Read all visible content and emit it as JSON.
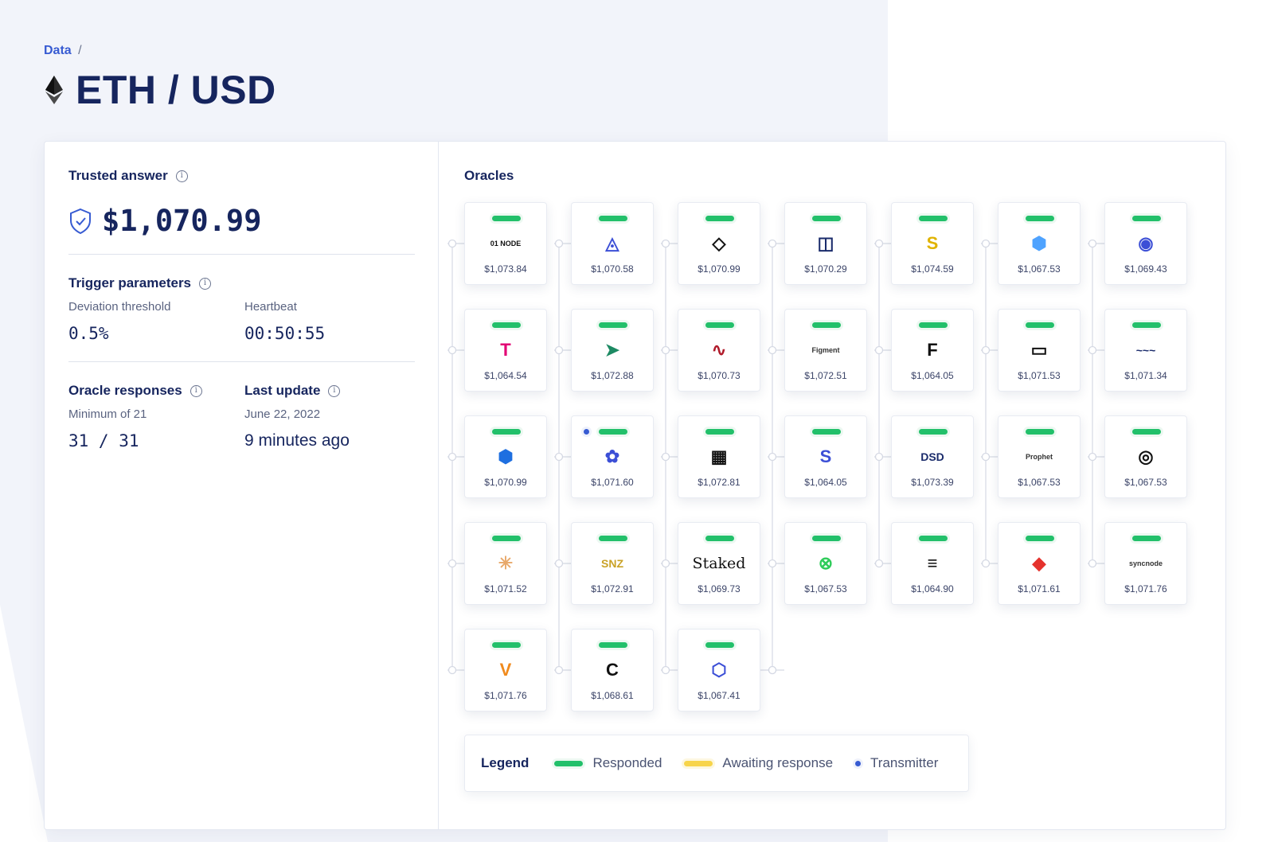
{
  "breadcrumb": {
    "root": "Data",
    "separator": "/"
  },
  "page": {
    "title": "ETH / USD",
    "icon": "ethereum-icon"
  },
  "trusted_answer": {
    "label": "Trusted answer",
    "value": "$1,070.99",
    "icon": "shield-check-icon"
  },
  "trigger": {
    "label": "Trigger parameters",
    "deviation_label": "Deviation threshold",
    "deviation_value": "0.5%",
    "heartbeat_label": "Heartbeat",
    "heartbeat_value": "00:50:55"
  },
  "responses": {
    "label": "Oracle responses",
    "sub": "Minimum of 21",
    "value": "31 / 31"
  },
  "last_update": {
    "label": "Last update",
    "date": "June 22, 2022",
    "relative": "9 minutes ago"
  },
  "oracles": {
    "title": "Oracles",
    "items": [
      {
        "logo": "01 NODE",
        "icon": "01node-logo-icon",
        "price": "$1,073.84",
        "status": "responded"
      },
      {
        "logo": "◬",
        "icon": "triangle-hex-logo-icon",
        "price": "$1,070.58",
        "status": "responded"
      },
      {
        "logo": "◇",
        "icon": "fox-mask-logo-icon",
        "price": "$1,070.99",
        "status": "responded"
      },
      {
        "logo": "◫",
        "icon": "square-grid-logo-icon",
        "price": "$1,070.29",
        "status": "responded"
      },
      {
        "logo": "S",
        "icon": "chain-link-logo-icon",
        "price": "$1,074.59",
        "status": "responded"
      },
      {
        "logo": "⬢",
        "icon": "cube-logo-icon",
        "price": "$1,067.53",
        "status": "responded"
      },
      {
        "logo": "◉",
        "icon": "hexagon-pin-logo-icon",
        "price": "$1,069.43",
        "status": "responded"
      },
      {
        "logo": "T",
        "icon": "telekom-logo-icon",
        "price": "$1,064.54",
        "status": "responded"
      },
      {
        "logo": "➤",
        "icon": "bird-logo-icon",
        "price": "$1,072.88",
        "status": "responded"
      },
      {
        "logo": "∿",
        "icon": "wave-logo-icon",
        "price": "$1,070.73",
        "status": "responded"
      },
      {
        "logo": "Figment",
        "icon": "figment-logo-icon",
        "price": "$1,072.51",
        "status": "responded"
      },
      {
        "logo": "F",
        "icon": "f-block-logo-icon",
        "price": "$1,064.05",
        "status": "responded"
      },
      {
        "logo": "▭",
        "icon": "rectangle-logo-icon",
        "price": "$1,071.53",
        "status": "responded"
      },
      {
        "logo": "~~~",
        "icon": "wordmark-logo-icon",
        "price": "$1,071.34",
        "status": "responded"
      },
      {
        "logo": "⬢",
        "icon": "hexagon-flame-logo-icon",
        "price": "$1,070.99",
        "status": "responded"
      },
      {
        "logo": "✿",
        "icon": "flower-logo-icon",
        "price": "$1,071.60",
        "status": "responded",
        "transmitter": true
      },
      {
        "logo": "▦",
        "icon": "blocks-logo-icon",
        "price": "$1,072.81",
        "status": "responded"
      },
      {
        "logo": "S",
        "icon": "hexagon-s-logo-icon",
        "price": "$1,064.05",
        "status": "responded"
      },
      {
        "logo": "DSD",
        "icon": "dsd-logo-icon",
        "price": "$1,073.39",
        "status": "responded"
      },
      {
        "logo": "Prophet",
        "icon": "prophet-logo-icon",
        "price": "$1,067.53",
        "status": "responded"
      },
      {
        "logo": "◎",
        "icon": "target-logo-icon",
        "price": "$1,067.53",
        "status": "responded"
      },
      {
        "logo": "✳",
        "icon": "network-logo-icon",
        "price": "$1,071.52",
        "status": "responded"
      },
      {
        "logo": "SNZ",
        "icon": "snz-logo-icon",
        "price": "$1,072.91",
        "status": "responded"
      },
      {
        "logo": "Staked",
        "icon": "staked-logo-icon",
        "price": "$1,069.73",
        "status": "responded"
      },
      {
        "logo": "⊗",
        "icon": "green-x-logo-icon",
        "price": "$1,067.53",
        "status": "responded"
      },
      {
        "logo": "≡",
        "icon": "stack-logo-icon",
        "price": "$1,064.90",
        "status": "responded"
      },
      {
        "logo": "◆",
        "icon": "swisscom-logo-icon",
        "price": "$1,071.61",
        "status": "responded"
      },
      {
        "logo": "syncnode",
        "icon": "syncnode-logo-icon",
        "price": "$1,071.76",
        "status": "responded"
      },
      {
        "logo": "V",
        "icon": "v-logo-icon",
        "price": "$1,071.76",
        "status": "responded"
      },
      {
        "logo": "C",
        "icon": "square-c-logo-icon",
        "price": "$1,068.61",
        "status": "responded"
      },
      {
        "logo": "⬡",
        "icon": "hexagon-blue-logo-icon",
        "price": "$1,067.41",
        "status": "responded"
      }
    ]
  },
  "legend": {
    "title": "Legend",
    "responded": "Responded",
    "awaiting": "Awaiting response",
    "transmitter": "Transmitter"
  },
  "colors": {
    "responded": "#22c06a",
    "awaiting": "#f7d44a",
    "transmitter": "#375bd2",
    "title": "#16255e",
    "link": "#375bd2"
  }
}
